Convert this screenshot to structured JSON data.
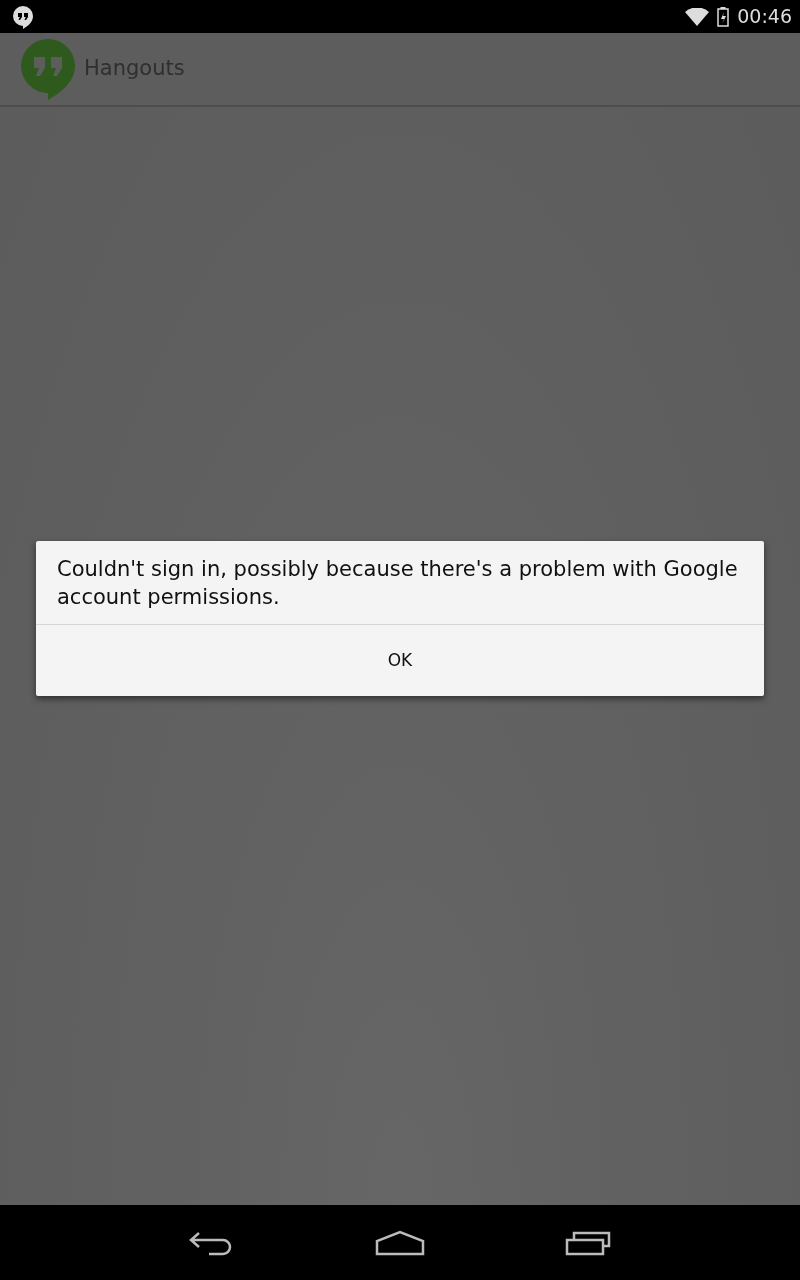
{
  "status_bar": {
    "time": "00:46"
  },
  "action_bar": {
    "title": "Hangouts"
  },
  "dialog": {
    "message": "Couldn't sign in, possibly because there's a problem with Google account permissions.",
    "buttons": [
      "OK"
    ]
  }
}
